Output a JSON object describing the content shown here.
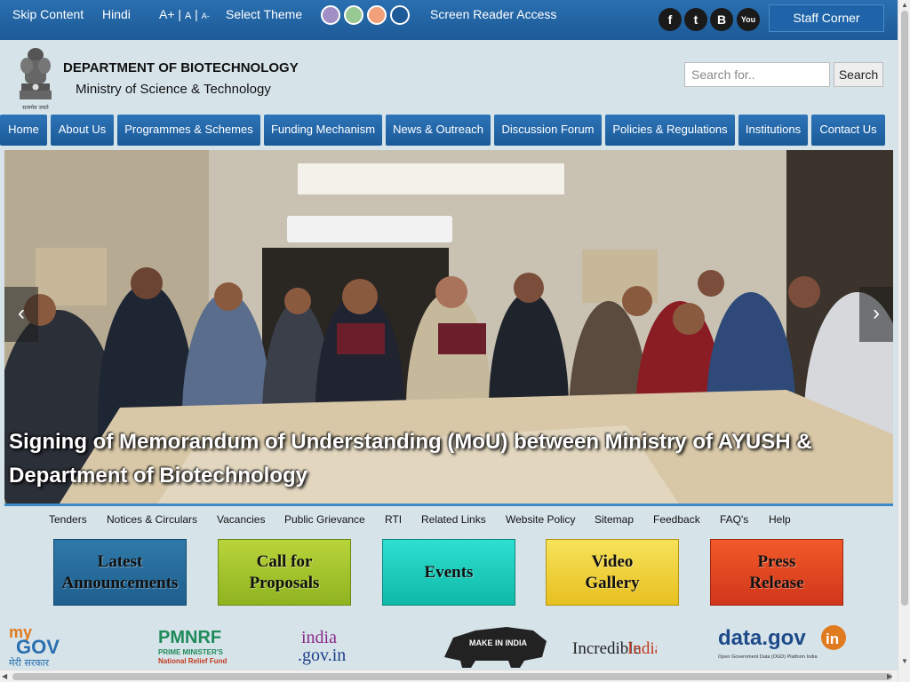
{
  "topbar": {
    "skip": "Skip Content",
    "hindi": "Hindi",
    "font_large": "A+",
    "font_normal": "A",
    "font_small": "A-",
    "sep": "|",
    "select_theme": "Select Theme",
    "theme_colors": [
      "#a08ec4",
      "#98c993",
      "#f2a07a",
      "#1d5a98"
    ],
    "screen_reader": "Screen Reader Access",
    "social": {
      "facebook": "f",
      "twitter": "t",
      "blogger": "B",
      "youtube": "You"
    },
    "staff_corner": "Staff Corner"
  },
  "header": {
    "emblem_caption": "सत्यमेव जयते",
    "department": "DEPARTMENT OF BIOTECHNOLOGY",
    "ministry": "Ministry of Science & Technology",
    "search_placeholder": "Search for..",
    "search_button": "Search"
  },
  "nav": [
    "Home",
    "About Us",
    "Programmes & Schemes",
    "Funding Mechanism",
    "News & Outreach",
    "Discussion Forum",
    "Policies & Regulations",
    "Institutions",
    "Contact Us"
  ],
  "slider": {
    "caption": "Signing of Memorandum of Understanding (MoU) between Ministry of AYUSH & Department of Biotechnology",
    "prev": "‹",
    "next": "›"
  },
  "footer_links": [
    "Tenders",
    "Notices & Circulars",
    "Vacancies",
    "Public Grievance",
    "RTI",
    "Related Links",
    "Website Policy",
    "Sitemap",
    "Feedback",
    "FAQ's",
    "Help"
  ],
  "tiles": [
    "Latest Announcements",
    "Call for Proposals",
    "Events",
    "Video Gallery",
    "Press Release"
  ],
  "logos": {
    "mygov_1": "my",
    "mygov_2": "GOV",
    "mygov_3": "मेरी सरकार",
    "pmnrf_1": "PMNRF",
    "pmnrf_2": "PRIME MINISTER'S",
    "pmnrf_3": "National Relief Fund",
    "india_1": "india",
    "india_2": ".gov.in",
    "makeinindia": "MAKE IN INDIA",
    "incredible": "Incredible",
    "incredible_india": "India",
    "datagov_1": "data.gov",
    "datagov_2": "in",
    "datagov_3": "Open Government Data (OGD) Platform India"
  }
}
